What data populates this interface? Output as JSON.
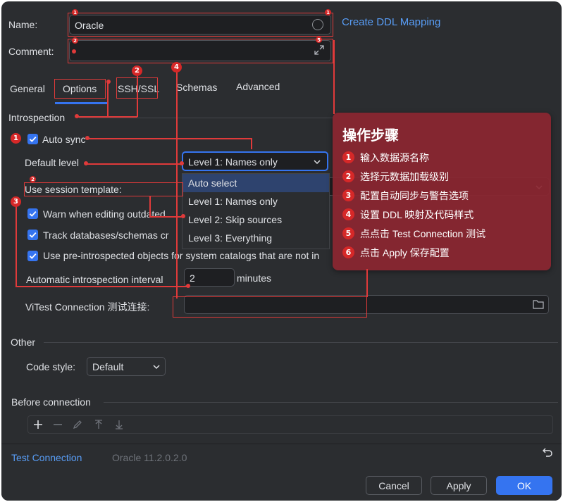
{
  "form": {
    "name_label": "Name:",
    "name_value": "Oracle",
    "comment_label": "Comment:",
    "create_ddl_link": "Create DDL Mapping"
  },
  "tabs": [
    "General",
    "Options",
    "SSH/SSL",
    "Schemas",
    "Advanced"
  ],
  "introspection": {
    "section_title": "Introspection",
    "auto_sync_label": "Auto sync",
    "auto_sync_checked": true,
    "default_level_label": "Default level",
    "default_level_value": "Level 1: Names only",
    "level_options": [
      "Auto select",
      "Level 1: Names only",
      "Level 2: Skip sources",
      "Level 3: Everything"
    ],
    "session_template_label": "Use session template:",
    "warn_label": "Warn when editing outdated",
    "track_label": "Track databases/schemas cr",
    "preintrospected_label": "Use pre-introspected objects for system catalogs that are not in",
    "interval_label": "Automatic introspection interval",
    "interval_value": "2",
    "interval_unit": "minutes",
    "test_conn_label_prefix": "Vi",
    "test_conn_label": "Test Connection 测试连接:"
  },
  "other": {
    "section_title": "Other",
    "code_style_label": "Code style:",
    "code_style_value": "Default"
  },
  "before_connection": {
    "section_title": "Before connection"
  },
  "footer": {
    "test_connection_link": "Test Connection",
    "driver_version": "Oracle 11.2.0.2.0",
    "cancel_label": "Cancel",
    "apply_label": "Apply",
    "ok_label": "OK"
  },
  "steps_panel": {
    "title": "操作步骤",
    "steps": [
      {
        "num": "1",
        "text": "输入数据源名称"
      },
      {
        "num": "2",
        "text": "选择元数据加载级别"
      },
      {
        "num": "3",
        "text": "配置自动同步与警告选项"
      },
      {
        "num": "4",
        "text": "设置 DDL 映射及代码样式"
      },
      {
        "num": "5",
        "text": "点点击 Test Connection 测试"
      },
      {
        "num": "6",
        "text": "点击 Apply 保存配置"
      }
    ]
  },
  "badges": {
    "b1": "1",
    "b2": "2",
    "b3": "3",
    "b4": "4",
    "b5": "5",
    "b6": "6"
  },
  "colors": {
    "background": "#2b2d30",
    "accent": "#3574f0",
    "link": "#589df6",
    "annotation_red": "#e03a3a",
    "panel": "#8b2630"
  }
}
